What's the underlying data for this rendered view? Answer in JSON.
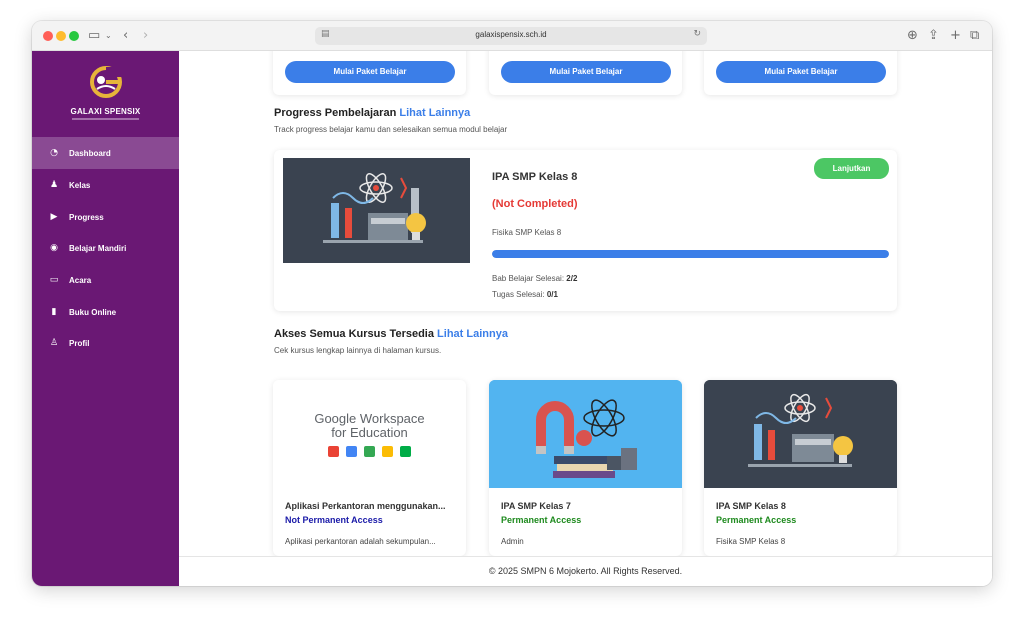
{
  "browser": {
    "url": "galaxispensix.sch.id"
  },
  "brand": {
    "title": "GALAXI SPENSIX"
  },
  "sidebar": {
    "items": [
      {
        "label": "Dashboard",
        "icon": "gauge-icon"
      },
      {
        "label": "Kelas",
        "icon": "class-icon"
      },
      {
        "label": "Progress",
        "icon": "play-icon"
      },
      {
        "label": "Belajar Mandiri",
        "icon": "play-circle-icon"
      },
      {
        "label": "Acara",
        "icon": "monitor-icon"
      },
      {
        "label": "Buku Online",
        "icon": "book-icon"
      },
      {
        "label": "Profil",
        "icon": "user-icon"
      }
    ]
  },
  "paket": {
    "button_label": "Mulai Paket Belajar"
  },
  "progress_section": {
    "title": "Progress Pembelajaran",
    "link": "Lihat Lainnya",
    "subtitle": "Track progress belajar kamu dan selesaikan semua modul belajar",
    "card": {
      "course": "IPA SMP Kelas 8",
      "status": "(Not Completed)",
      "subtitle": "Fisika SMP Kelas 8",
      "progress": 1.0,
      "bab_label": "Bab Belajar Selesai:",
      "bab_value": "2/2",
      "tugas_label": "Tugas Selesai:",
      "tugas_value": "0/1",
      "continue_label": "Lanjutkan"
    }
  },
  "courses_section": {
    "title": "Akses Semua Kursus Tersedia",
    "link": "Lihat Lainnya",
    "subtitle": "Cek kursus lengkap lainnya di halaman kursus.",
    "courses": [
      {
        "image_text_1": "Google Workspace",
        "image_text_2": "for Education",
        "title": "Aplikasi Perkantoran menggunakan...",
        "access": "Not Permanent Access",
        "access_color": "#1a1aa8",
        "desc": "Aplikasi perkantoran adalah sekumpulan..."
      },
      {
        "title": "IPA SMP Kelas 7",
        "access": "Permanent Access",
        "access_color": "#1e8a1e",
        "desc": "Admin"
      },
      {
        "title": "IPA SMP Kelas 8",
        "access": "Permanent Access",
        "access_color": "#1e8a1e",
        "desc": "Fisika SMP Kelas 8"
      }
    ]
  },
  "footer": {
    "text": "© 2025 SMPN 6 Mojokerto. All Rights Reserved."
  },
  "colors": {
    "sidebar": "#6a1874",
    "accent": "#3b7ee8",
    "success": "#4cc764",
    "danger": "#e53935"
  }
}
